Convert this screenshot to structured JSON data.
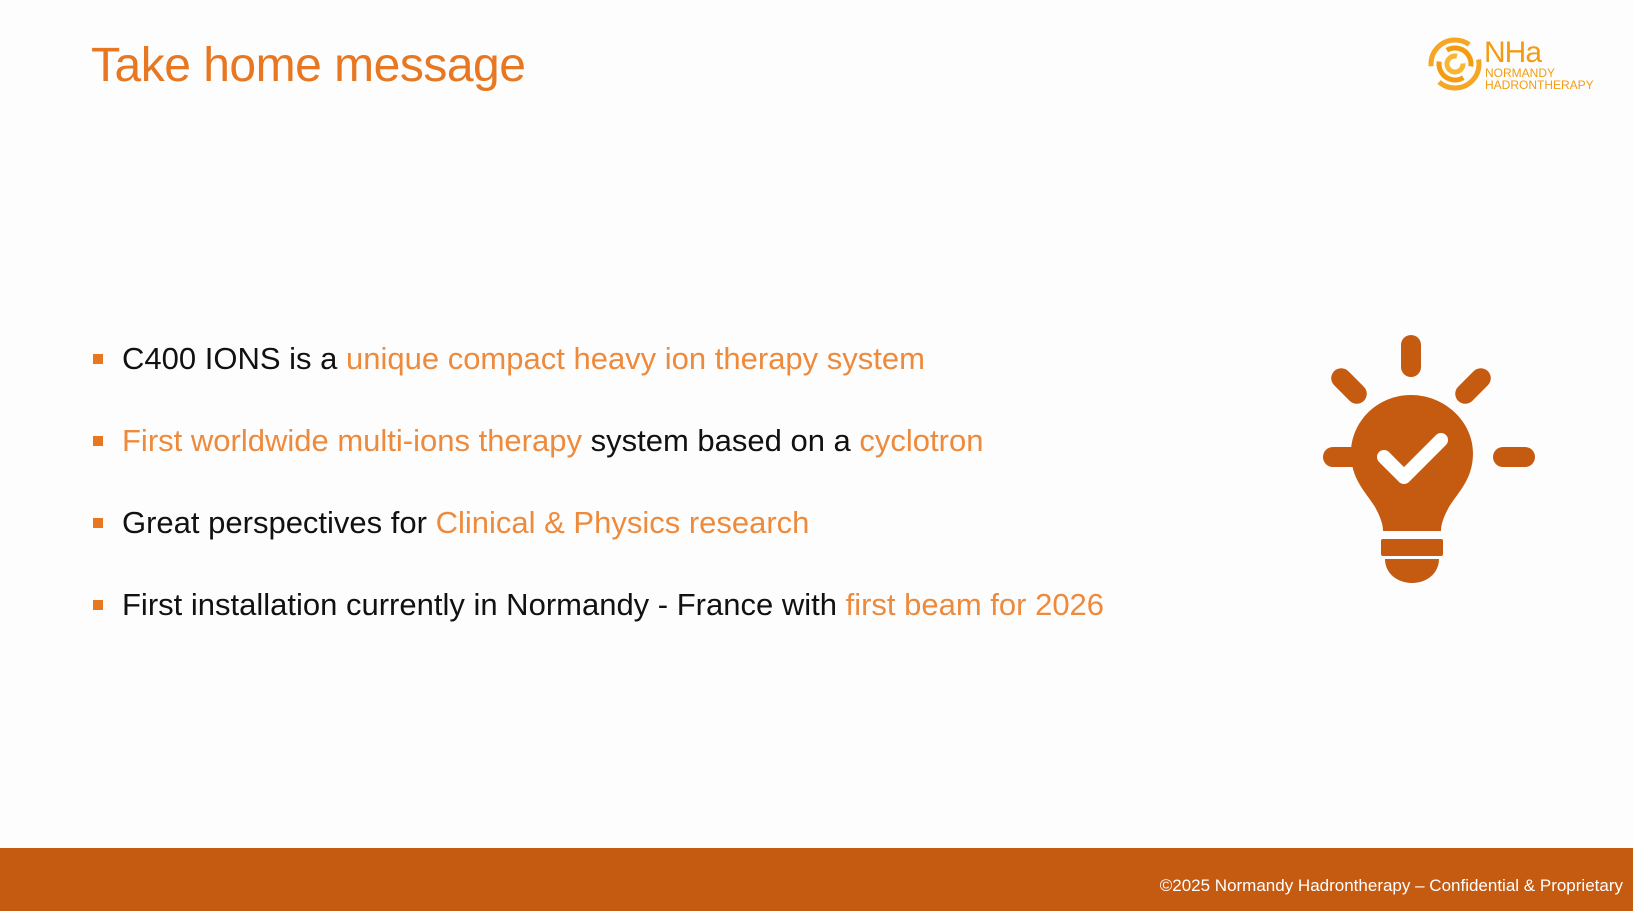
{
  "slide": {
    "title": "Take home message",
    "logo": {
      "letters": "NHa",
      "line1": "NORMANDY",
      "line2": "HADRONTHERAPY",
      "icon": "swirl-logo-icon"
    },
    "bullets": [
      {
        "parts": [
          "C400 IONS is a ",
          "unique compact heavy ion therapy system"
        ]
      },
      {
        "parts": [
          "First worldwide multi-ions therapy",
          " system based on a ",
          "cyclotron"
        ]
      },
      {
        "parts": [
          "Great perspectives for ",
          "Clinical & Physics research"
        ]
      },
      {
        "parts": [
          "First installation currently in Normandy  - France with ",
          "first beam for 2026"
        ]
      }
    ],
    "illustration_icon": "lightbulb-check-icon",
    "footer": "©2025  Normandy Hadrontherapy – Confidential & Proprietary"
  },
  "colors": {
    "title": "#e87722",
    "highlight": "#ee8a3c",
    "body_text": "#111111",
    "bulb": "#c55a11",
    "footer_bar": "#c55a11",
    "logo": "#f39c12"
  }
}
